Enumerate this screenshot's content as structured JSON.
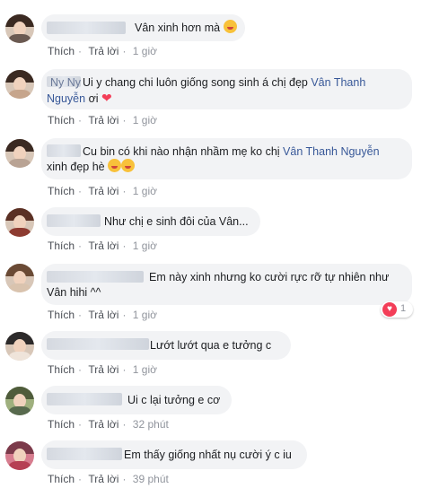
{
  "comments": [
    {
      "author_visible": "",
      "text": "Vân xinh hơn mà",
      "mention": "",
      "after": "",
      "emoji": "grinning-squinting-tongue",
      "like": "Thích",
      "reply": "Trả lời",
      "time": "1 giờ"
    },
    {
      "author_visible": "Ny Ny",
      "text": "Ui y chang chi luôn giống song sinh á chị đẹp ",
      "mention": "Vân Thanh Nguyễn",
      "after": " ơi",
      "emoji": "heart",
      "like": "Thích",
      "reply": "Trả lời",
      "time": "1 giờ"
    },
    {
      "author_visible": "",
      "text": "Cu bin có khi nào nhận nhầm mẹ ko chị ",
      "mention": "Vân Thanh Nguyễn",
      "after": "xinh đẹp hè",
      "emoji": "smiling-face-with-hearts",
      "like": "Thích",
      "reply": "Trả lời",
      "time": "1 giờ"
    },
    {
      "author_visible": "",
      "text": "Như chị e sinh đôi của Vân...",
      "mention": "",
      "after": "",
      "emoji": "",
      "like": "Thích",
      "reply": "Trả lời",
      "time": "1 giờ"
    },
    {
      "author_visible": "",
      "text": "Em này xinh nhưng ko cười rực rỡ tự nhiên như",
      "mention": "",
      "after": "Vân hihi ^^",
      "emoji": "",
      "like": "Thích",
      "reply": "Trả lời",
      "time": "1 giờ",
      "reaction_count": "1"
    },
    {
      "author_visible": "",
      "text": "Lướt lướt qua e tưởng c",
      "mention": "",
      "after": "",
      "emoji": "",
      "like": "Thích",
      "reply": "Trả lời",
      "time": "1 giờ"
    },
    {
      "author_visible": "",
      "text": "Ui c lại tưởng e cơ",
      "mention": "",
      "after": "",
      "emoji": "",
      "like": "Thích",
      "reply": "Trả lời",
      "time": "32 phút"
    },
    {
      "author_visible": "",
      "text": "Em thấy giống nhất nụ cười ý c iu",
      "mention": "",
      "after": "",
      "emoji": "",
      "like": "Thích",
      "reply": "Trả lời",
      "time": "39 phút"
    }
  ],
  "colors": {
    "link": "#385898",
    "bubble": "#f2f3f5",
    "meta": "#90949c",
    "love": "#f33e58"
  }
}
